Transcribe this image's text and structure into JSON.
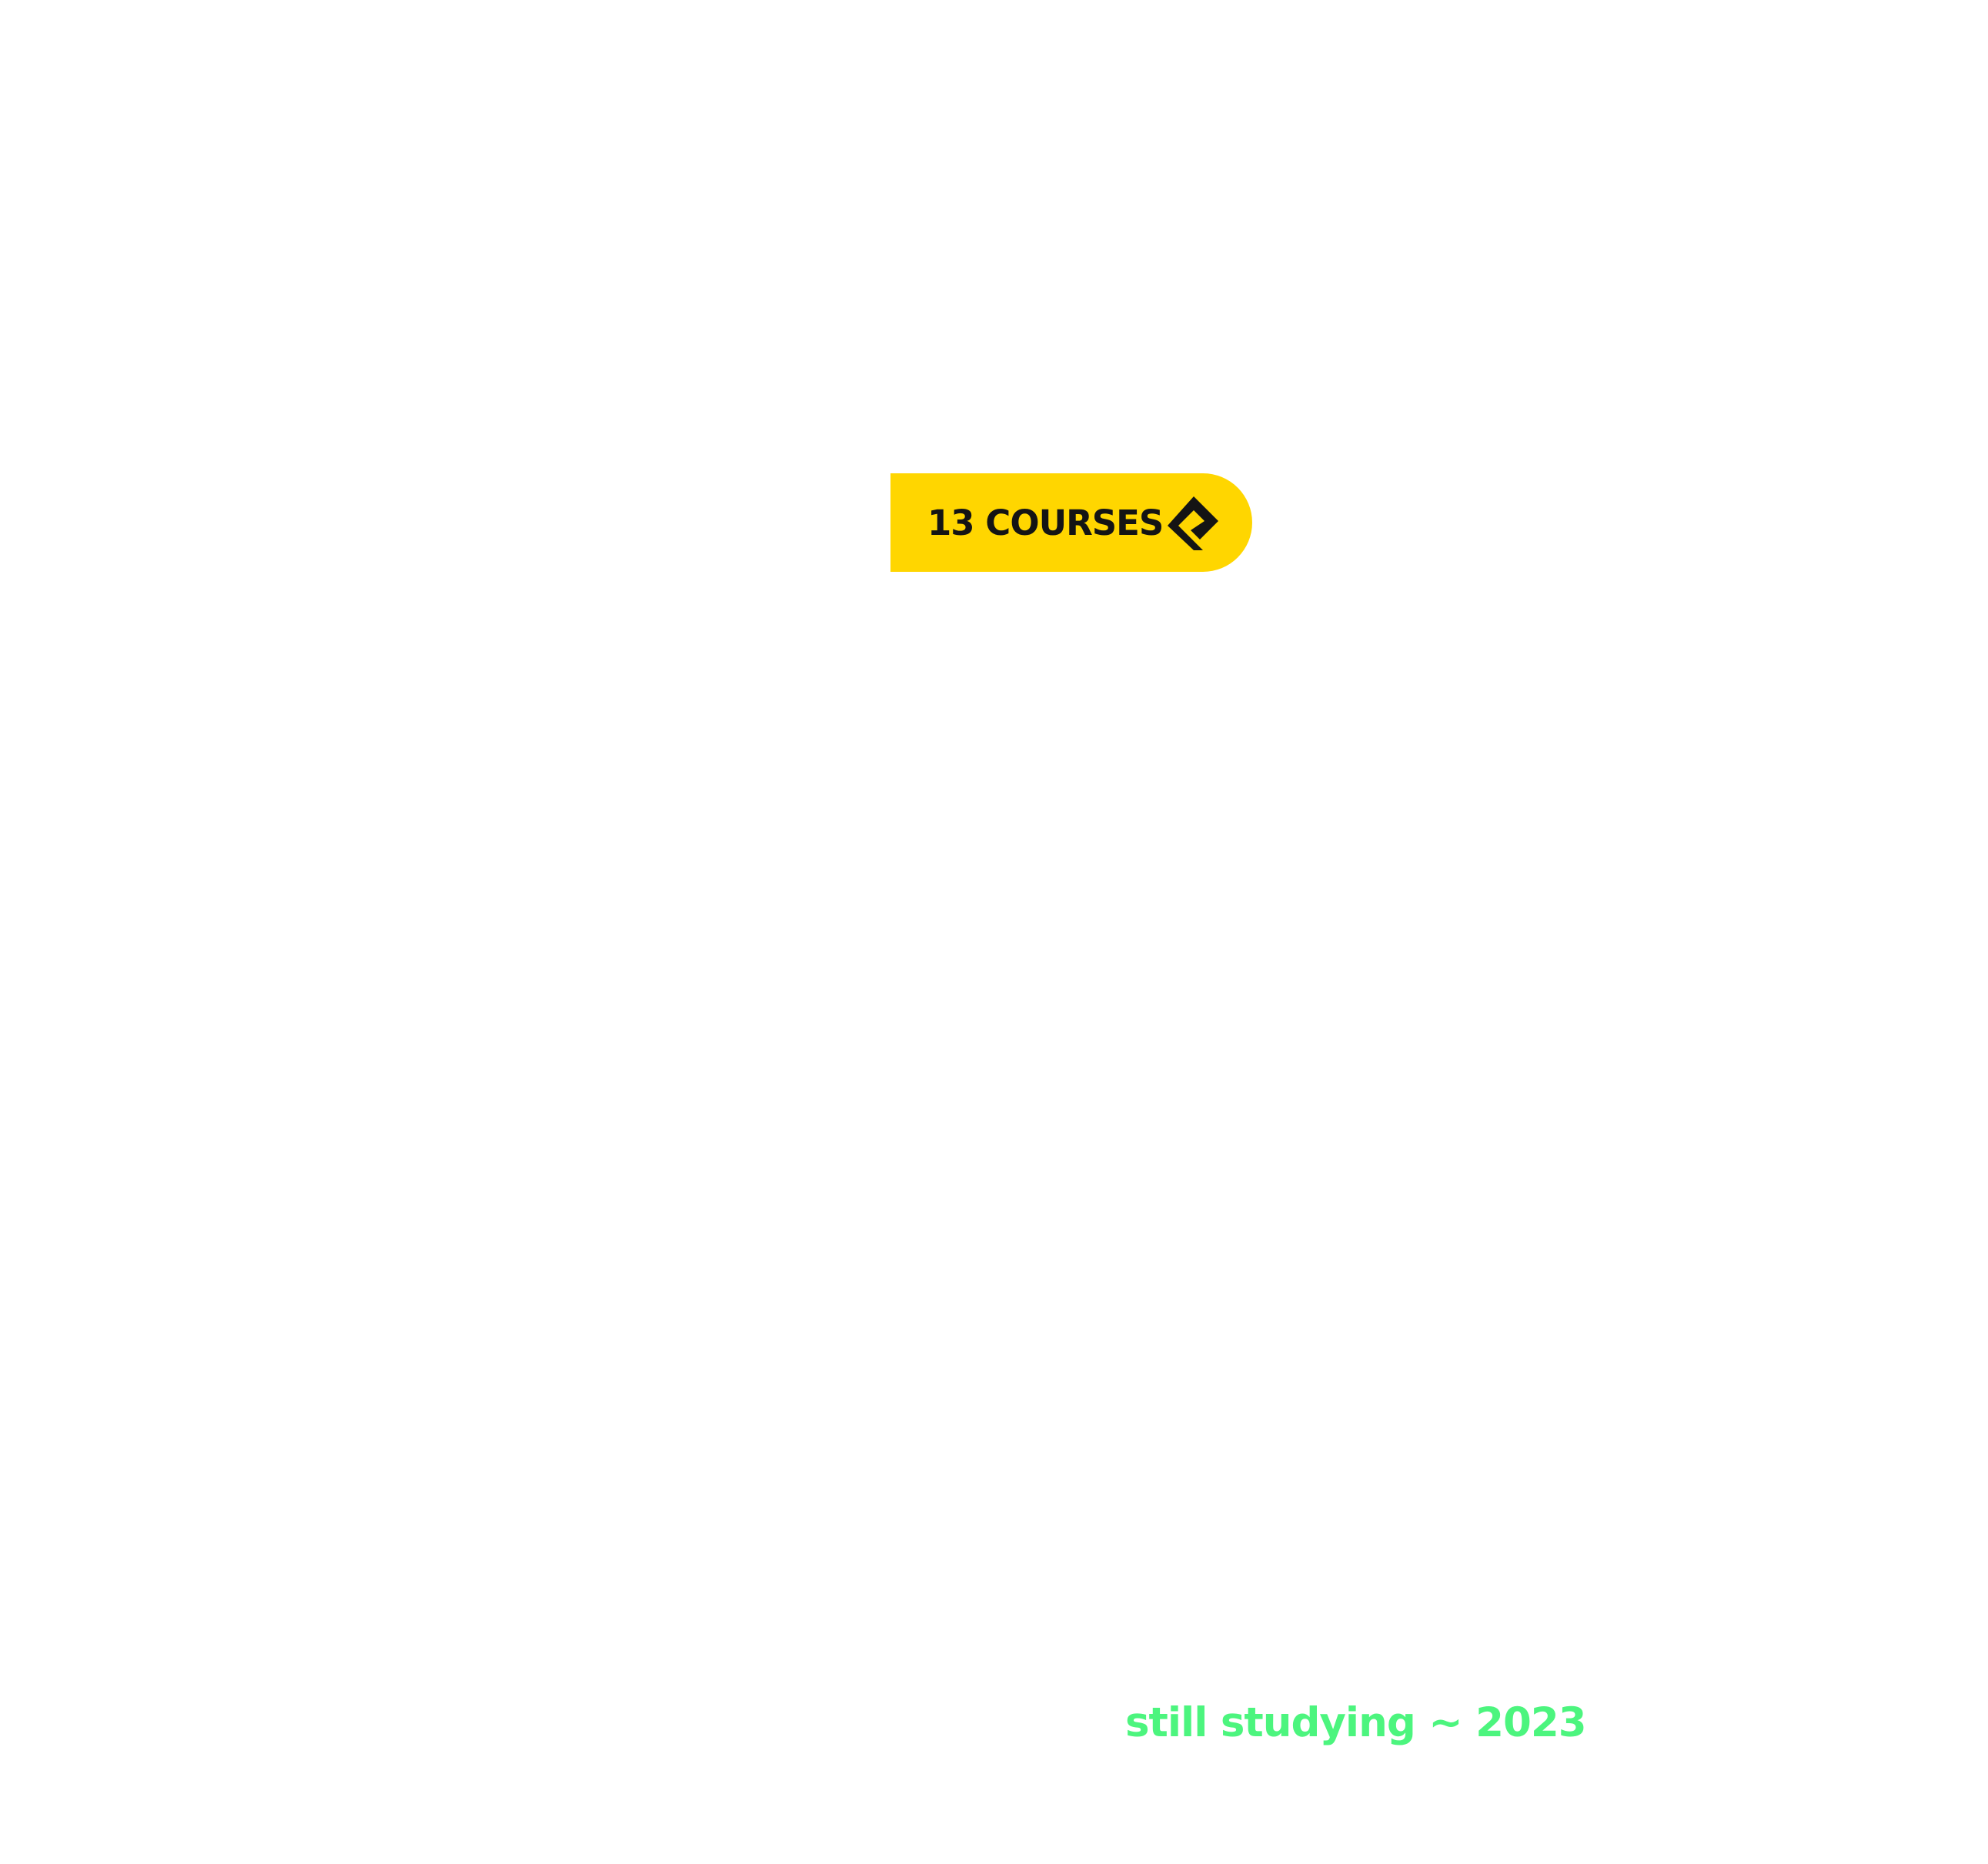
{
  "badge": {
    "label": "13 COURSES",
    "icon": "diamond-logo-icon",
    "color": "#ffd600",
    "text_color": "#141414"
  },
  "status": {
    "text": "still studying ~ 2023",
    "color": "#4cf57e"
  }
}
